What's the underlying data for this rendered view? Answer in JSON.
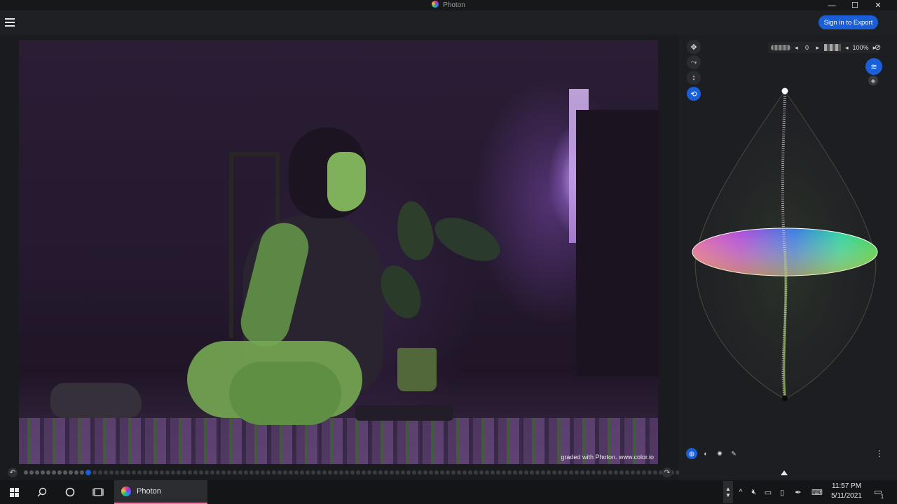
{
  "window": {
    "title": "Photon",
    "minimize": "—",
    "maximize": "☐",
    "close": "✕"
  },
  "header": {
    "sign_in_label": "Sign in to Export"
  },
  "viewer": {
    "watermark": "graded with Photon. www.color.io",
    "undo_icon": "↶",
    "redo_icon": "↷",
    "timeline_selected_index": 11,
    "timeline_count": 140
  },
  "panel": {
    "tools": [
      "move-icon",
      "curve-tool-icon",
      "vertical-arrows-icon",
      "rotate-icon"
    ],
    "tool_glyphs": [
      "✥",
      "⤳",
      "↕",
      "⟲"
    ],
    "noise_value": "0",
    "opacity_value": "100%",
    "arrow_left": "◂",
    "arrow_right": "▸",
    "right_buttons": [
      "layers-icon",
      "paint-bucket-icon"
    ],
    "bottom_tabs": [
      "globe-icon",
      "contrast-icon",
      "sparkle-icon",
      "eyedropper-icon"
    ],
    "tab_glyphs": [
      "◍",
      "◐",
      "✺",
      "✎"
    ],
    "more_icon": "⋮"
  },
  "taskbar": {
    "app_label": "Photon",
    "time": "11:57 PM",
    "date": "5/11/2021",
    "notification_count": "1"
  },
  "colors": {
    "accent": "#1a5fd8",
    "background": "#1b1c1f"
  }
}
